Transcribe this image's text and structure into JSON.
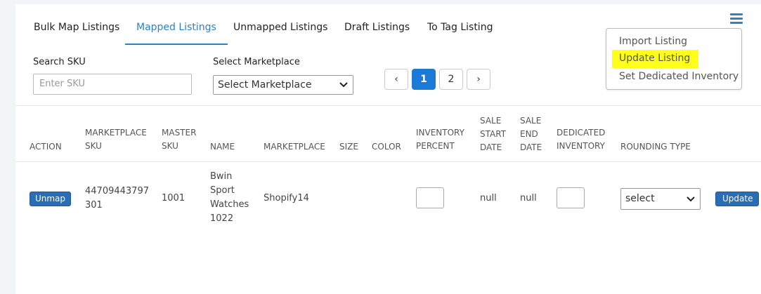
{
  "tabs": [
    {
      "label": "Bulk Map Listings"
    },
    {
      "label": "Mapped Listings"
    },
    {
      "label": "Unmapped Listings"
    },
    {
      "label": "Draft Listings"
    },
    {
      "label": "To Tag Listing"
    }
  ],
  "menu": {
    "items": [
      {
        "label": "Import Listing"
      },
      {
        "label": "Update Listing"
      },
      {
        "label": "Set Dedicated Inventory"
      }
    ]
  },
  "filters": {
    "sku_label": "Search SKU",
    "sku_placeholder": "Enter SKU",
    "marketplace_label": "Select Marketplace",
    "marketplace_value": "Select Marketplace"
  },
  "pagination": {
    "prev": "‹",
    "pages": [
      "1",
      "2"
    ],
    "next": "›"
  },
  "table": {
    "headers": {
      "action": "ACTION",
      "marketplace_sku_1": "MARKETPLACE",
      "marketplace_sku_2": "SKU",
      "master_sku_1": "MASTER",
      "master_sku_2": "SKU",
      "name": "NAME",
      "marketplace": "MARKETPLACE",
      "size": "SIZE",
      "color": "COLOR",
      "inventory_percent_1": "INVENTORY",
      "inventory_percent_2": "PERCENT",
      "sale_start_1": "SALE",
      "sale_start_2": "START",
      "sale_start_3": "DATE",
      "sale_end_1": "SALE",
      "sale_end_2": "END",
      "sale_end_3": "DATE",
      "dedicated_1": "DEDICATED",
      "dedicated_2": "INVENTORY",
      "rounding_type": "ROUNDING TYPE"
    },
    "rows": [
      {
        "action": "Unmap",
        "marketplace_sku_1": "44709443797",
        "marketplace_sku_2": "301",
        "master_sku": "1001",
        "name_1": "Bwin",
        "name_2": "Sport",
        "name_3": "Watches",
        "name_4": "1022",
        "marketplace": "Shopify14",
        "sale_start": "null",
        "sale_end": "null",
        "rounding": "select",
        "update": "Update"
      }
    ]
  },
  "colors": {
    "accent": "#2f80c9",
    "highlight": "#ffff1a",
    "button": "#2a6db5"
  }
}
